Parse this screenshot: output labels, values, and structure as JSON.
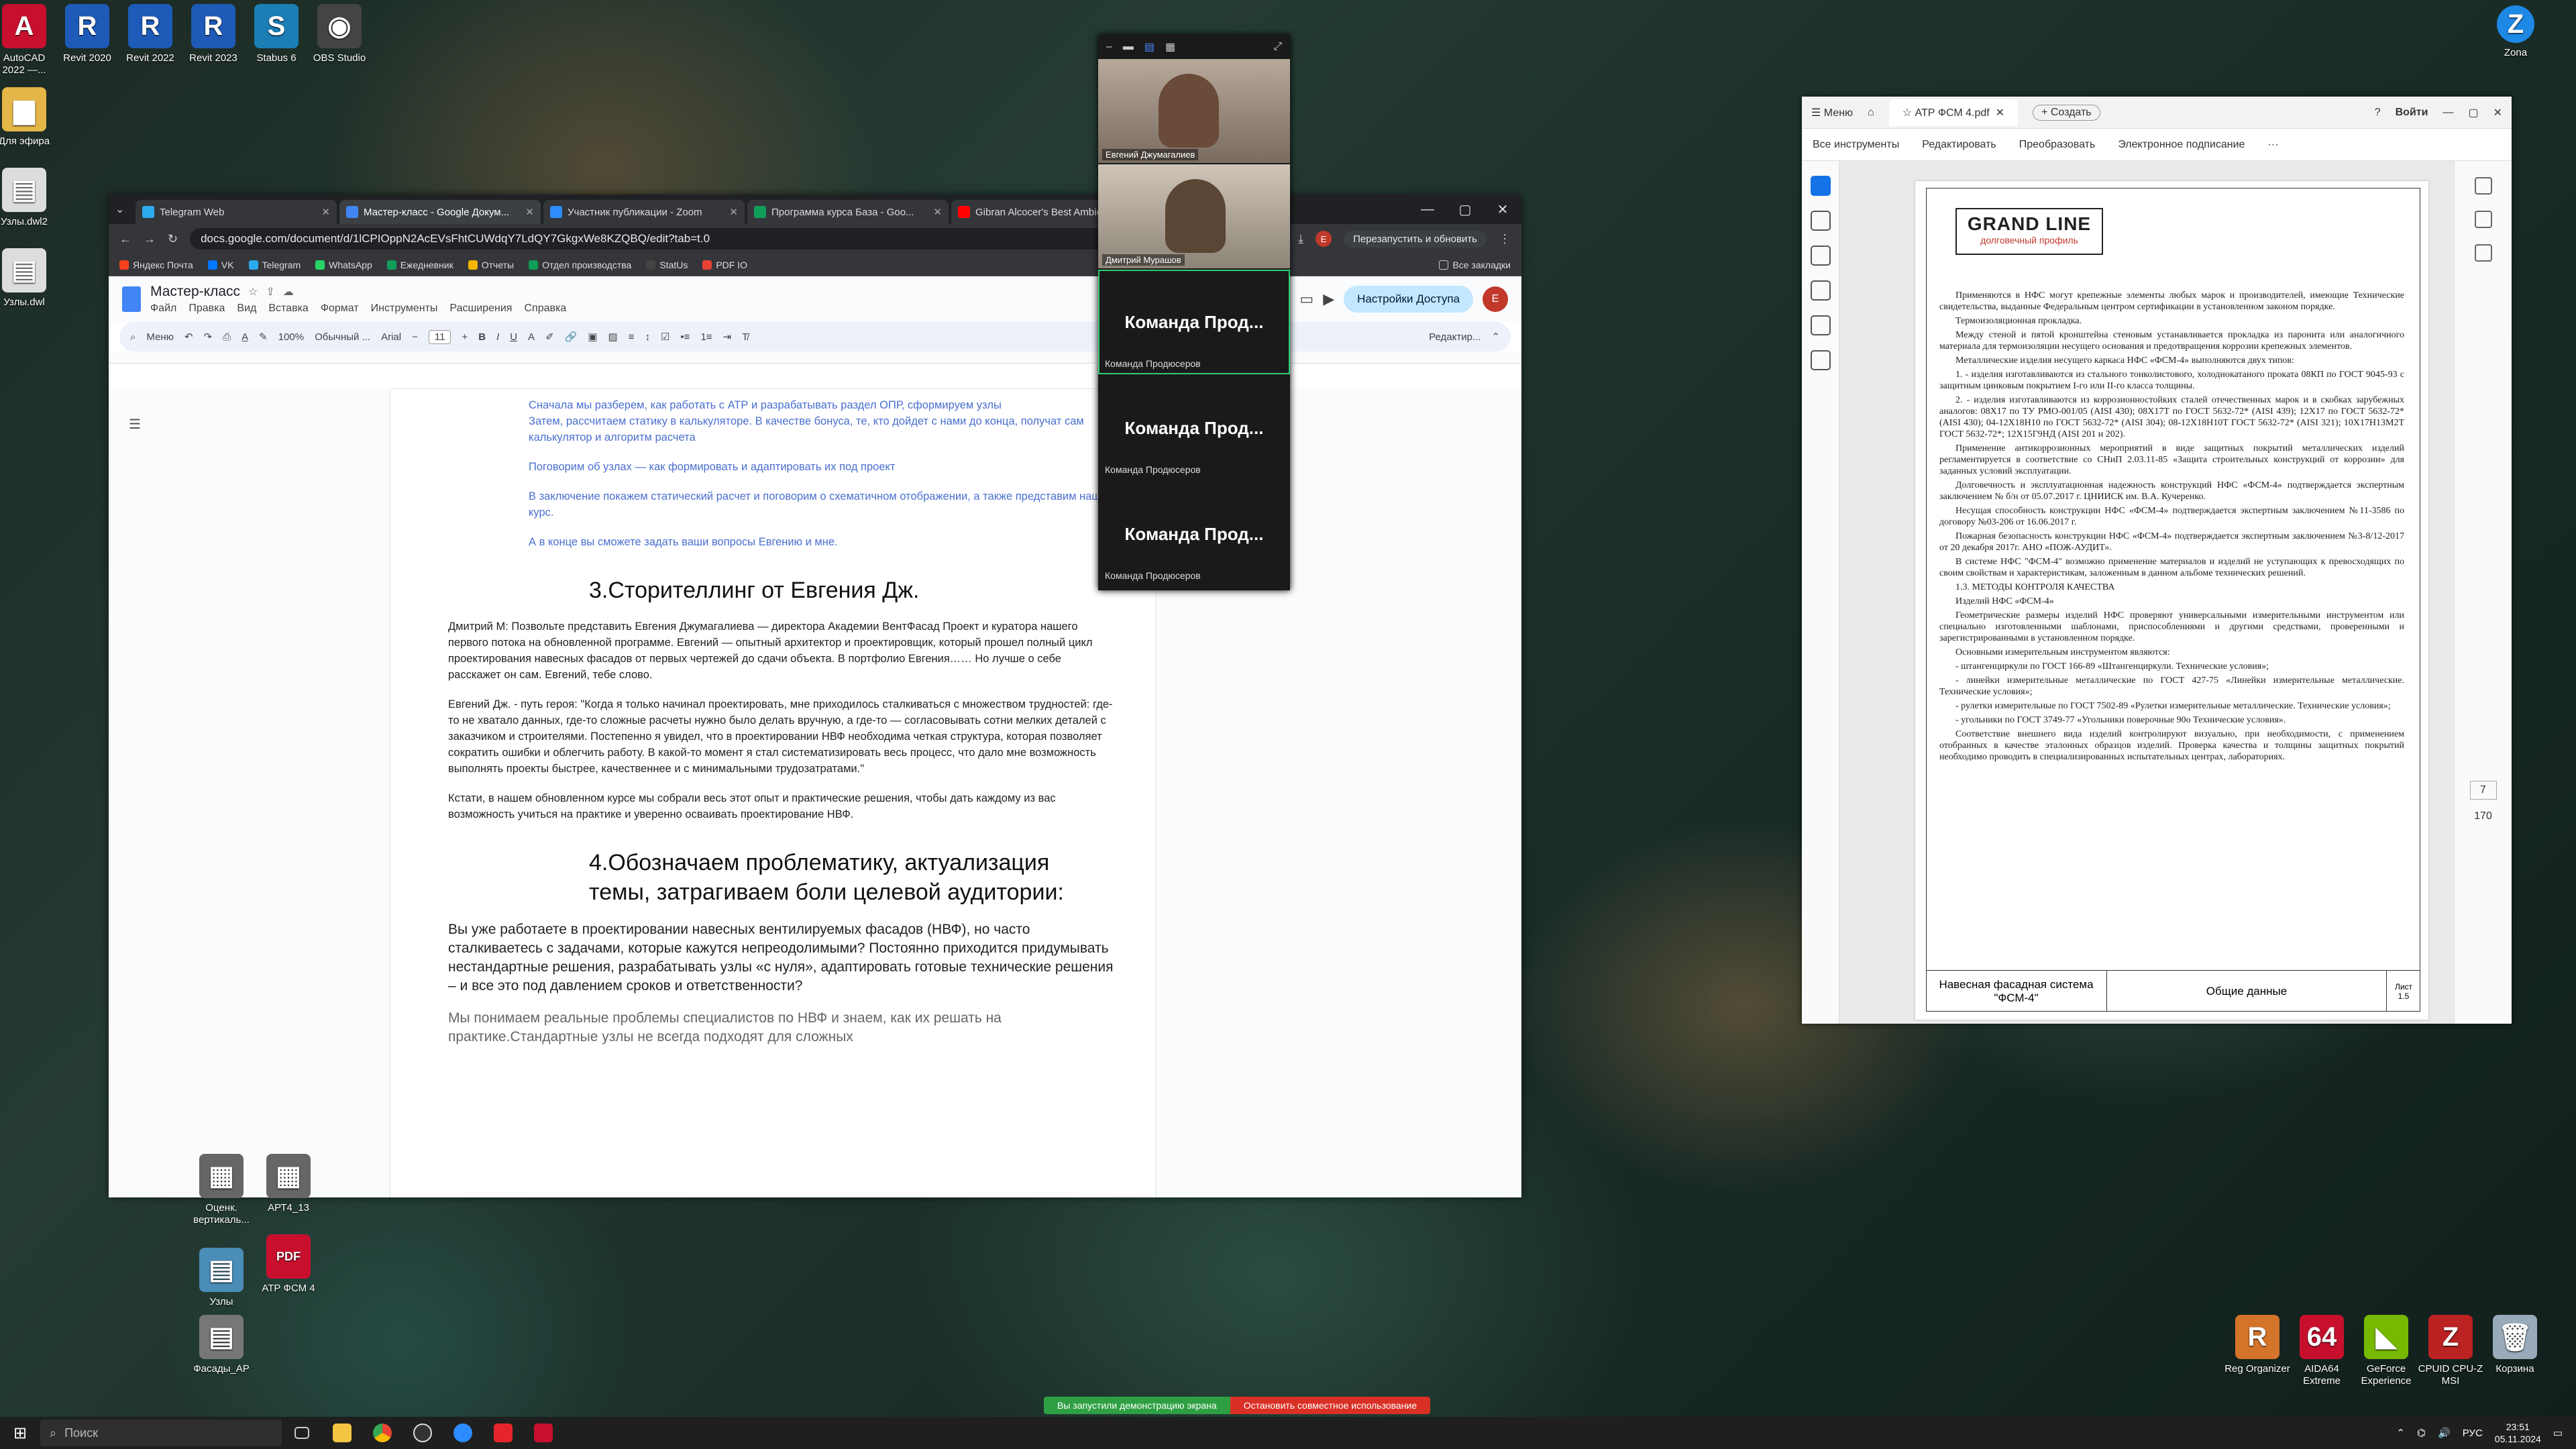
{
  "desktop": {
    "icons_top": [
      {
        "label": "AutoCAD 2022 —...",
        "color": "#c8102e",
        "glyph": "A"
      },
      {
        "label": "Revit 2020",
        "color": "#1e5bb8",
        "glyph": "R"
      },
      {
        "label": "Revit 2022",
        "color": "#1e5bb8",
        "glyph": "R"
      },
      {
        "label": "Revit 2023",
        "color": "#1e5bb8",
        "glyph": "R"
      },
      {
        "label": "Stabus 6",
        "color": "#1b7fb5",
        "glyph": "S"
      },
      {
        "label": "OBS Studio",
        "color": "#444",
        "glyph": "◉"
      }
    ],
    "icons_left": [
      {
        "label": "Для эфира",
        "color": "#e4b547",
        "glyph": "▆"
      },
      {
        "label": "Узлы.dwl2",
        "color": "#ddd",
        "glyph": "▤"
      },
      {
        "label": "Узлы.dwl",
        "color": "#ddd",
        "glyph": "▤"
      }
    ],
    "icons_bottom_left": [
      {
        "label": "Оценк. вертикаль...",
        "color": "#666",
        "glyph": "▦"
      },
      {
        "label": "АРТ4_13",
        "color": "#666",
        "glyph": "▦"
      },
      {
        "label": "Узлы",
        "color": "#4a8db7",
        "glyph": "▤"
      },
      {
        "label": "АТР ФСМ 4",
        "color": "#c8102e",
        "glyph": "PDF"
      },
      {
        "label": "Фасады_АР",
        "color": "#777",
        "glyph": "▤"
      }
    ],
    "icons_bottom_right": [
      {
        "label": "Reg Organizer",
        "color": "#d4742a",
        "glyph": "R"
      },
      {
        "label": "AIDA64 Extreme",
        "color": "#c8102e",
        "glyph": "64"
      },
      {
        "label": "GeForce Experience",
        "color": "#76b900",
        "glyph": "◣"
      },
      {
        "label": "CPUID CPU-Z MSI",
        "color": "#b22",
        "glyph": "Z"
      },
      {
        "label": "Корзина",
        "color": "#9ab",
        "glyph": "🗑"
      }
    ],
    "zona": {
      "label": "Zona",
      "glyph": "Z"
    }
  },
  "chrome": {
    "tabs": [
      {
        "title": "Telegram Web",
        "color": "#2aabee",
        "active": false
      },
      {
        "title": "Мастер-класс - Google Докум...",
        "color": "#4285f4",
        "active": true
      },
      {
        "title": "Участник публикации - Zoom",
        "color": "#2d8cff",
        "active": false
      },
      {
        "title": "Программа курса База - Goo...",
        "color": "#0f9d58",
        "active": false
      },
      {
        "title": "Gibran Alcocer's Best Ambien...",
        "color": "#ff0000",
        "active": false
      }
    ],
    "url": "docs.google.com/document/d/1lCPIOppN2AcEVsFhtCUWdqY7LdQY7GkgxWe8KZQBQ/edit?tab=t.0",
    "relaunch": "Перезапустить и обновить",
    "bookmarks": [
      {
        "label": "Яндекс Почта",
        "color": "#fc3f1d"
      },
      {
        "label": "VK",
        "color": "#0077ff"
      },
      {
        "label": "Telegram",
        "color": "#2aabee"
      },
      {
        "label": "WhatsApp",
        "color": "#25d366"
      },
      {
        "label": "Ежедневник",
        "color": "#0f9d58"
      },
      {
        "label": "Отчеты",
        "color": "#f4b400"
      },
      {
        "label": "Отдел производства",
        "color": "#0f9d58"
      },
      {
        "label": "StatUs",
        "color": "#444"
      },
      {
        "label": "PDF IO",
        "color": "#e94235"
      }
    ],
    "all_bookmarks": "Все закладки"
  },
  "docs": {
    "title": "Мастер-класс",
    "menus": [
      "Файл",
      "Правка",
      "Вид",
      "Вставка",
      "Формат",
      "Инструменты",
      "Расширения",
      "Справка"
    ],
    "share": "Настройки Доступа",
    "toolbar": {
      "menu": "Меню",
      "zoom": "100%",
      "style": "Обычный ...",
      "font": "Arial",
      "size": "11",
      "edit": "Редактир..."
    },
    "paragraphs_blue": [
      "Сначала мы разберем, как работать с АТР и разрабатывать раздел ОПР, сформируем узлы",
      "Затем, рассчитаем статику в калькуляторе. В качестве бонуса, те, кто дойдет с нами до конца, получат сам калькулятор и алгоритм расчета",
      "Поговорим об узлах — как формировать и адаптировать их под проект",
      "В заключение покажем статический расчет и поговорим о схематичном отображении, а также представим наш курс.",
      "А в конце вы сможете задать ваши вопросы Евгению и мне."
    ],
    "heading3": "3.Сторителлинг от Евгения Дж.",
    "p_dmitry": "Дмитрий М: Позвольте представить Евгения Джумагалиева — директора Академии ВентФасад Проект и куратора нашего первого потока на обновленной программе. Евгений — опытный архитектор и проектировщик, который прошел полный цикл проектирования навесных фасадов от первых чертежей до сдачи объекта. В портфолио Евгения…… Но лучше о себе расскажет он сам. Евгений, тебе слово.",
    "p_evgeny": "Евгений Дж. - путь героя: \"Когда я только начинал проектировать, мне приходилось сталкиваться с множеством трудностей: где-то не хватало данных, где-то сложные расчеты нужно было делать вручную, а где-то — согласовывать сотни мелких деталей с заказчиком и строителями. Постепенно я увидел, что в проектировании НВФ необходима четкая структура, которая позволяет сократить ошибки и облегчить работу. В какой-то момент я стал систематизировать весь процесс, что дало мне возможность выполнять проекты быстрее, качественнее и с минимальными трудозатратами.\"",
    "p_kstati": "Кстати, в нашем обновленном курсе мы собрали весь этот опыт и практические решения, чтобы дать каждому из вас возможность учиться на практике и уверенно осваивать проектирование НВФ.",
    "heading4": "4.Обозначаем проблематику, актуализация темы, затрагиваем боли целевой аудитории:",
    "p_big1": "Вы уже работаете в проектировании навесных вентилируемых фасадов (НВФ), но часто сталкиваетесь с задачами, которые кажутся непреодолимыми? Постоянно приходится придумывать нестандартные решения, разрабатывать узлы «с нуля», адаптировать готовые технические решения – и все это под давлением сроков и ответственности?",
    "p_big2": "Мы понимаем реальные проблемы специалистов по НВФ и знаем, как их решать на практике.Стандартные узлы не всегда подходят для сложных"
  },
  "zoom": {
    "participants": [
      {
        "name": "Евгений Джумагалиев"
      },
      {
        "name": "Дмитрий Мурашов"
      }
    ],
    "tiles": [
      {
        "title": "Команда Прод...",
        "sub": "Команда Продюсеров",
        "active": true
      },
      {
        "title": "Команда Прод...",
        "sub": "Команда Продюсеров",
        "active": false
      },
      {
        "title": "Команда Прод...",
        "sub": "Команда Продюсеров",
        "active": false
      }
    ]
  },
  "acrobat": {
    "menu": "Меню",
    "doc_tab": "АТР ФСМ 4.pdf",
    "create": "+ Создать",
    "signin": "Войти",
    "tools": [
      "Все инструменты",
      "Редактировать",
      "Преобразовать",
      "Электронное подписание"
    ],
    "logo": "GRAND LINE",
    "logo_sub": "долговечный профиль",
    "page_text": [
      "Применяются в НФС могут крепежные элементы любых марок и производителей, имеющие Технические свидетельства, выданные Федеральным центром сертификации в установленном законом порядке.",
      "Термоизоляционная прокладка.",
      "Между стеной и пятой кронштейна стеновым устанавливается прокладка из паронита или аналогичного материала для термоизоляции несущего основания и предотвращения коррозии крепежных элементов.",
      "Металлические изделия несущего каркаса НФС «ФСМ-4» выполняются двух типов:",
      "1. - изделия изготавливаются из стального тонколистового, холоднокатаного проката 08КП по ГОСТ 9045-93 с защитным цинковым покрытием I-го или II-го класса толщины.",
      "2. - изделия изготавливаются из коррозионностойких сталей отечественных марок и в скобках зарубежных аналогов: 08Х17 по ТУ РМО-001/05 (AISI 430); 08Х17Т по ГОСТ 5632-72* (AISI 439); 12Х17 по ГОСТ 5632-72* (AISI 430); 04-12Х18Н10 по ГОСТ 5632-72* (AISI 304); 08-12Х18Н10Т ГОСТ 5632-72* (AISI 321); 10Х17Н13М2Т ГОСТ 5632-72*; 12Х15Г9НД (AISI 201 и 202).",
      "Применение антикоррозионных мероприятий в виде защитных покрытий металлических изделий регламентируется в соответствие со СНиП 2.03.11-85 «Защита строительных конструкций от коррозии» для заданных условий эксплуатации.",
      "Долговечность и эксплуатационная надежность конструкций НФС «ФСМ-4» подтверждается экспертным заключением № б/н от 05.07.2017 г. ЦНИИСК им. В.А. Кучеренко.",
      "Несущая способность конструкции НФС «ФСМ-4» подтверждается экспертным заключением №11-3586 по договору №03-206 от 16.06.2017 г.",
      "Пожарная безопасность конструкции НФС «ФСМ-4» подтверждается экспертным заключением №3-8/12-2017 от 20 декабря 2017г. АНО «ПОЖ-АУДИТ».",
      "В системе НФС \"ФСМ-4\" возможно применение материалов и изделий не уступающих к превосходящих по своим свойствам и характеристикам, заложенным в данном альбоме технических решений.",
      "1.3. МЕТОДЫ КОНТРОЛЯ КАЧЕСТВА",
      "Изделий НФС «ФСМ-4»",
      "Геометрические размеры изделий НФС проверяют универсальными измерительными инструментом или специально изготовленными шаблонами, приспособлениями и другими средствами, проверенными и зарегистрированными в установленном порядке.",
      "Основными измерительным инструментом являются:",
      "- штангенциркули по ГОСТ 166-89 «Штангенциркули. Технические условия»;",
      "- линейки измерительные металлические по ГОСТ 427-75 «Линейки измерительные металлические. Технические условия»;",
      "- рулетки измерительные по ГОСТ 7502-89 «Рулетки измерительные металлические. Технические условия»;",
      "- угольники по ГОСТ 3749-77 «Угольники поверочные 90о Технические условия».",
      "Соответствие внешнего вида изделий контролируют визуально, при необходимости, с применением отобранных в качестве эталонных образцов изделий. Проверка качества и толщины защитных покрытий необходимо проводить в специализированных испытательных центрах, лабораториях."
    ],
    "stamp_left": "Навесная фасадная система \"ФСМ-4\"",
    "stamp_mid": "Общие данные",
    "stamp_sheet": "Лист",
    "stamp_num": "1.5",
    "page_num": "7",
    "page_total": "170"
  },
  "share_bar": {
    "sharing": "Вы запустили демонстрацию экрана",
    "stop": "Остановить совместное использование"
  },
  "taskbar": {
    "search": "Поиск",
    "lang": "РУС",
    "time": "23:51",
    "date": "05.11.2024"
  }
}
